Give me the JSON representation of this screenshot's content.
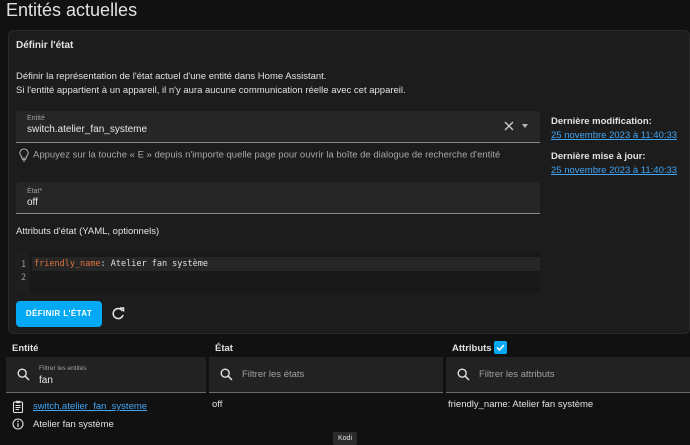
{
  "page": {
    "title": "Entités actuelles"
  },
  "set_state_card": {
    "title": "Définir l'état",
    "description_line1": "Définir la représentation de l'état actuel d'une entité dans Home Assistant.",
    "description_line2": "Si l'entité appartient à un appareil, il n'y aura aucune communication réelle avec cet appareil.",
    "entity_field": {
      "label": "Entité",
      "value": "switch.atelier_fan_systeme",
      "icons": [
        "close-icon",
        "caret-down-icon"
      ]
    },
    "hint": {
      "icon": "lightbulb-icon",
      "text": "Appuyez sur la touche « E » depuis n'importe quelle page pour ouvrir la boîte de dialogue de recherche d'entité"
    },
    "state_field": {
      "label": "État*",
      "value": "off"
    },
    "attributes_title": "Attributs d'état (YAML, optionnels)",
    "yaml_editor": {
      "line_numbers": [
        "1",
        "2"
      ],
      "line1_key": "friendly_name",
      "line1_sep": ":",
      "line1_value": " Atelier fan système"
    },
    "set_state_button": "DÉFINIR L'ÉTAT",
    "refresh_icon": "refresh-icon",
    "last_changed_label": "Dernière modification:",
    "last_changed_value": "25 novembre 2023 à 11:40:33",
    "last_updated_label": "Dernière mise à jour:",
    "last_updated_value": "25 novembre 2023 à 11:40:33"
  },
  "table": {
    "headers": {
      "entity": "Entité",
      "state": "État",
      "attributes": "Attributs"
    },
    "attributes_checkbox_checked": true,
    "filters": {
      "entity": {
        "label": "Filtrer les entités",
        "value": "fan"
      },
      "state": {
        "placeholder": "Filtrer les états"
      },
      "attributes": {
        "placeholder": "Filtrer les attributs"
      }
    },
    "rows": [
      {
        "entity_id": "switch.atelier_fan_systeme",
        "friendly_name": "Atelier fan système",
        "state": "off",
        "attributes": "friendly_name: Atelier fan système"
      }
    ]
  },
  "tooltip": {
    "text": "Kodi"
  },
  "colors": {
    "accent": "#03a9f4",
    "link": "#42a5f5",
    "background": "#111111",
    "card": "#1c1c1c",
    "yaml_key": "#e0713c"
  }
}
